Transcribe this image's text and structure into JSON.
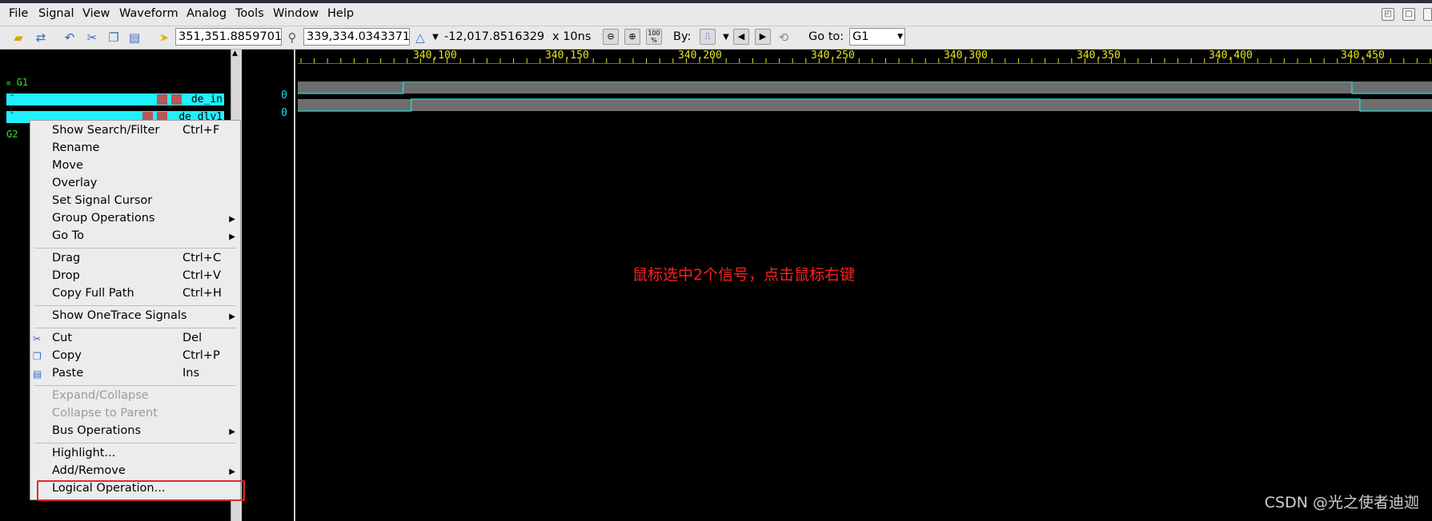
{
  "menubar": {
    "items": [
      "File",
      "Signal",
      "View",
      "Waveform",
      "Analog",
      "Tools",
      "Window",
      "Help"
    ]
  },
  "toolbar": {
    "cursor1_value": "351,351.8859701",
    "cursor2_value": "339,334.0343371",
    "delta_value": "-12,017.8516329",
    "unit": "x 10ns",
    "by_label": "By:",
    "goto_label": "Go to:",
    "goto_value": "G1",
    "zoom_100_label": "100 %",
    "icons": [
      "open-folder-icon",
      "refresh-icon",
      "undo-icon",
      "cut-icon",
      "copy-icon",
      "paste-icon",
      "cursor-arrow-icon",
      "cursor-marker-icon",
      "delta-icon",
      "zoom-out-icon",
      "zoom-in-icon",
      "zoom-100-icon",
      "edge-search-icon",
      "prev-icon",
      "next-icon",
      "back-icon"
    ]
  },
  "signal_pane": {
    "groups": [
      {
        "label": "G1"
      },
      {
        "label": "G2"
      }
    ],
    "signals": [
      {
        "name": "de_in",
        "value": "0"
      },
      {
        "name": "de_dly1",
        "value": "0"
      }
    ]
  },
  "ruler": {
    "labels": [
      "340,100",
      "340,150",
      "340,200",
      "340,250",
      "340,300",
      "340,350",
      "340,400",
      "340,450"
    ]
  },
  "waveforms": [
    {
      "signal": "de_in",
      "rise_at": 340096,
      "fall_at": 340453
    },
    {
      "signal": "de_dly1",
      "rise_at": 340099,
      "fall_at": 340456
    }
  ],
  "context_menu": {
    "items": [
      {
        "label": "Show Search/Filter",
        "shortcut": "Ctrl+F"
      },
      {
        "label": "Rename",
        "shortcut": ""
      },
      {
        "label": "Move",
        "shortcut": ""
      },
      {
        "label": "Overlay",
        "shortcut": ""
      },
      {
        "label": "Set Signal Cursor",
        "shortcut": ""
      },
      {
        "label": "Group Operations",
        "shortcut": "",
        "submenu": true
      },
      {
        "label": "Go To",
        "shortcut": "",
        "submenu": true
      },
      {
        "label": "Drag",
        "shortcut": "Ctrl+C"
      },
      {
        "label": "Drop",
        "shortcut": "Ctrl+V"
      },
      {
        "label": "Copy Full Path",
        "shortcut": "Ctrl+H"
      },
      {
        "label": "Show OneTrace Signals",
        "shortcut": "",
        "submenu": true
      },
      {
        "label": "Cut",
        "shortcut": "Del",
        "icon": "cut-icon"
      },
      {
        "label": "Copy",
        "shortcut": "Ctrl+P",
        "icon": "copy-icon"
      },
      {
        "label": "Paste",
        "shortcut": "Ins",
        "icon": "paste-icon"
      },
      {
        "label": "Expand/Collapse",
        "shortcut": "",
        "disabled": true
      },
      {
        "label": "Collapse to Parent",
        "shortcut": "",
        "disabled": true
      },
      {
        "label": "Bus Operations",
        "shortcut": "",
        "submenu": true
      },
      {
        "label": "Highlight...",
        "shortcut": ""
      },
      {
        "label": "Add/Remove",
        "shortcut": "",
        "submenu": true
      },
      {
        "label": "Logical Operation...",
        "shortcut": ""
      }
    ]
  },
  "annotation": "鼠标选中2个信号，点击鼠标右键",
  "watermark": "CSDN @光之使者迪迦",
  "colors": {
    "signal_highlight": "#1ff1ff",
    "wave_line": "#1fe0e0",
    "wave_fill": "#6e6e6e",
    "ruler_text": "#e6e61a",
    "group_text": "#2ee82e",
    "annotation_red": "#ff2020"
  }
}
